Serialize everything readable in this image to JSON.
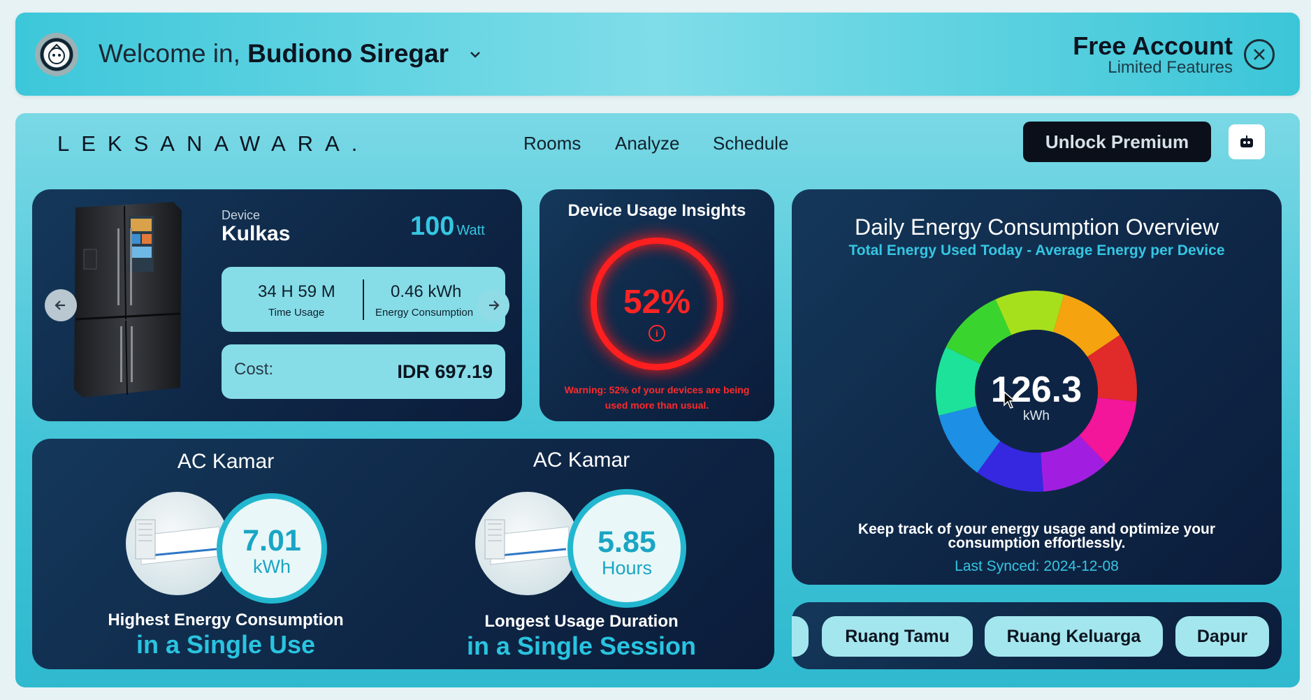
{
  "header": {
    "welcome_prefix": "Welcome in,",
    "user_name": "Budiono Siregar",
    "account_type": "Free Account",
    "account_note": "Limited Features"
  },
  "nav": {
    "logo": "LEKSANAWARA.",
    "links": [
      "Rooms",
      "Analyze",
      "Schedule"
    ],
    "premium_button": "Unlock Premium"
  },
  "device": {
    "label": "Device",
    "name": "Kulkas",
    "power": "100",
    "power_unit": "Watt",
    "time_usage": "34 H 59 M",
    "time_usage_label": "Time Usage",
    "energy": "0.46 kWh",
    "energy_label": "Energy Consumption",
    "cost_label": "Cost:",
    "cost_value": "IDR 697.19"
  },
  "insights": {
    "title": "Device Usage Insights",
    "percent": "52%",
    "percent_value": 52,
    "warning": "Warning: 52% of your devices are being used more than usual."
  },
  "daily": {
    "title": "Daily Energy Consumption Overview",
    "subtitle": "Total Energy Used Today - Average Energy per Device",
    "total": "126.3",
    "unit": "kWh",
    "description": "Keep track of your energy usage and optimize your consumption effortlessly.",
    "last_synced": "Last Synced: 2024-12-08",
    "segment_colors": [
      "#a6e01c",
      "#f5a40f",
      "#e12a2a",
      "#f3159a",
      "#a11ee0",
      "#3528e0",
      "#1d8fe4",
      "#1de39a",
      "#3ad42f"
    ]
  },
  "highlights": [
    {
      "title": "AC Kamar",
      "value": "7.01",
      "unit": "kWh",
      "line1": "Highest Energy Consumption",
      "line2": "in a Single Use"
    },
    {
      "title": "AC Kamar",
      "value": "5.85",
      "unit": "Hours",
      "line1": "Longest Usage Duration",
      "line2": "in a Single Session"
    }
  ],
  "rooms": [
    "Ruang Tamu",
    "Ruang Keluarga",
    "Dapur"
  ],
  "colors": {
    "accent": "#35c6e2",
    "warning": "#ff2424",
    "card": "#0f2747"
  }
}
